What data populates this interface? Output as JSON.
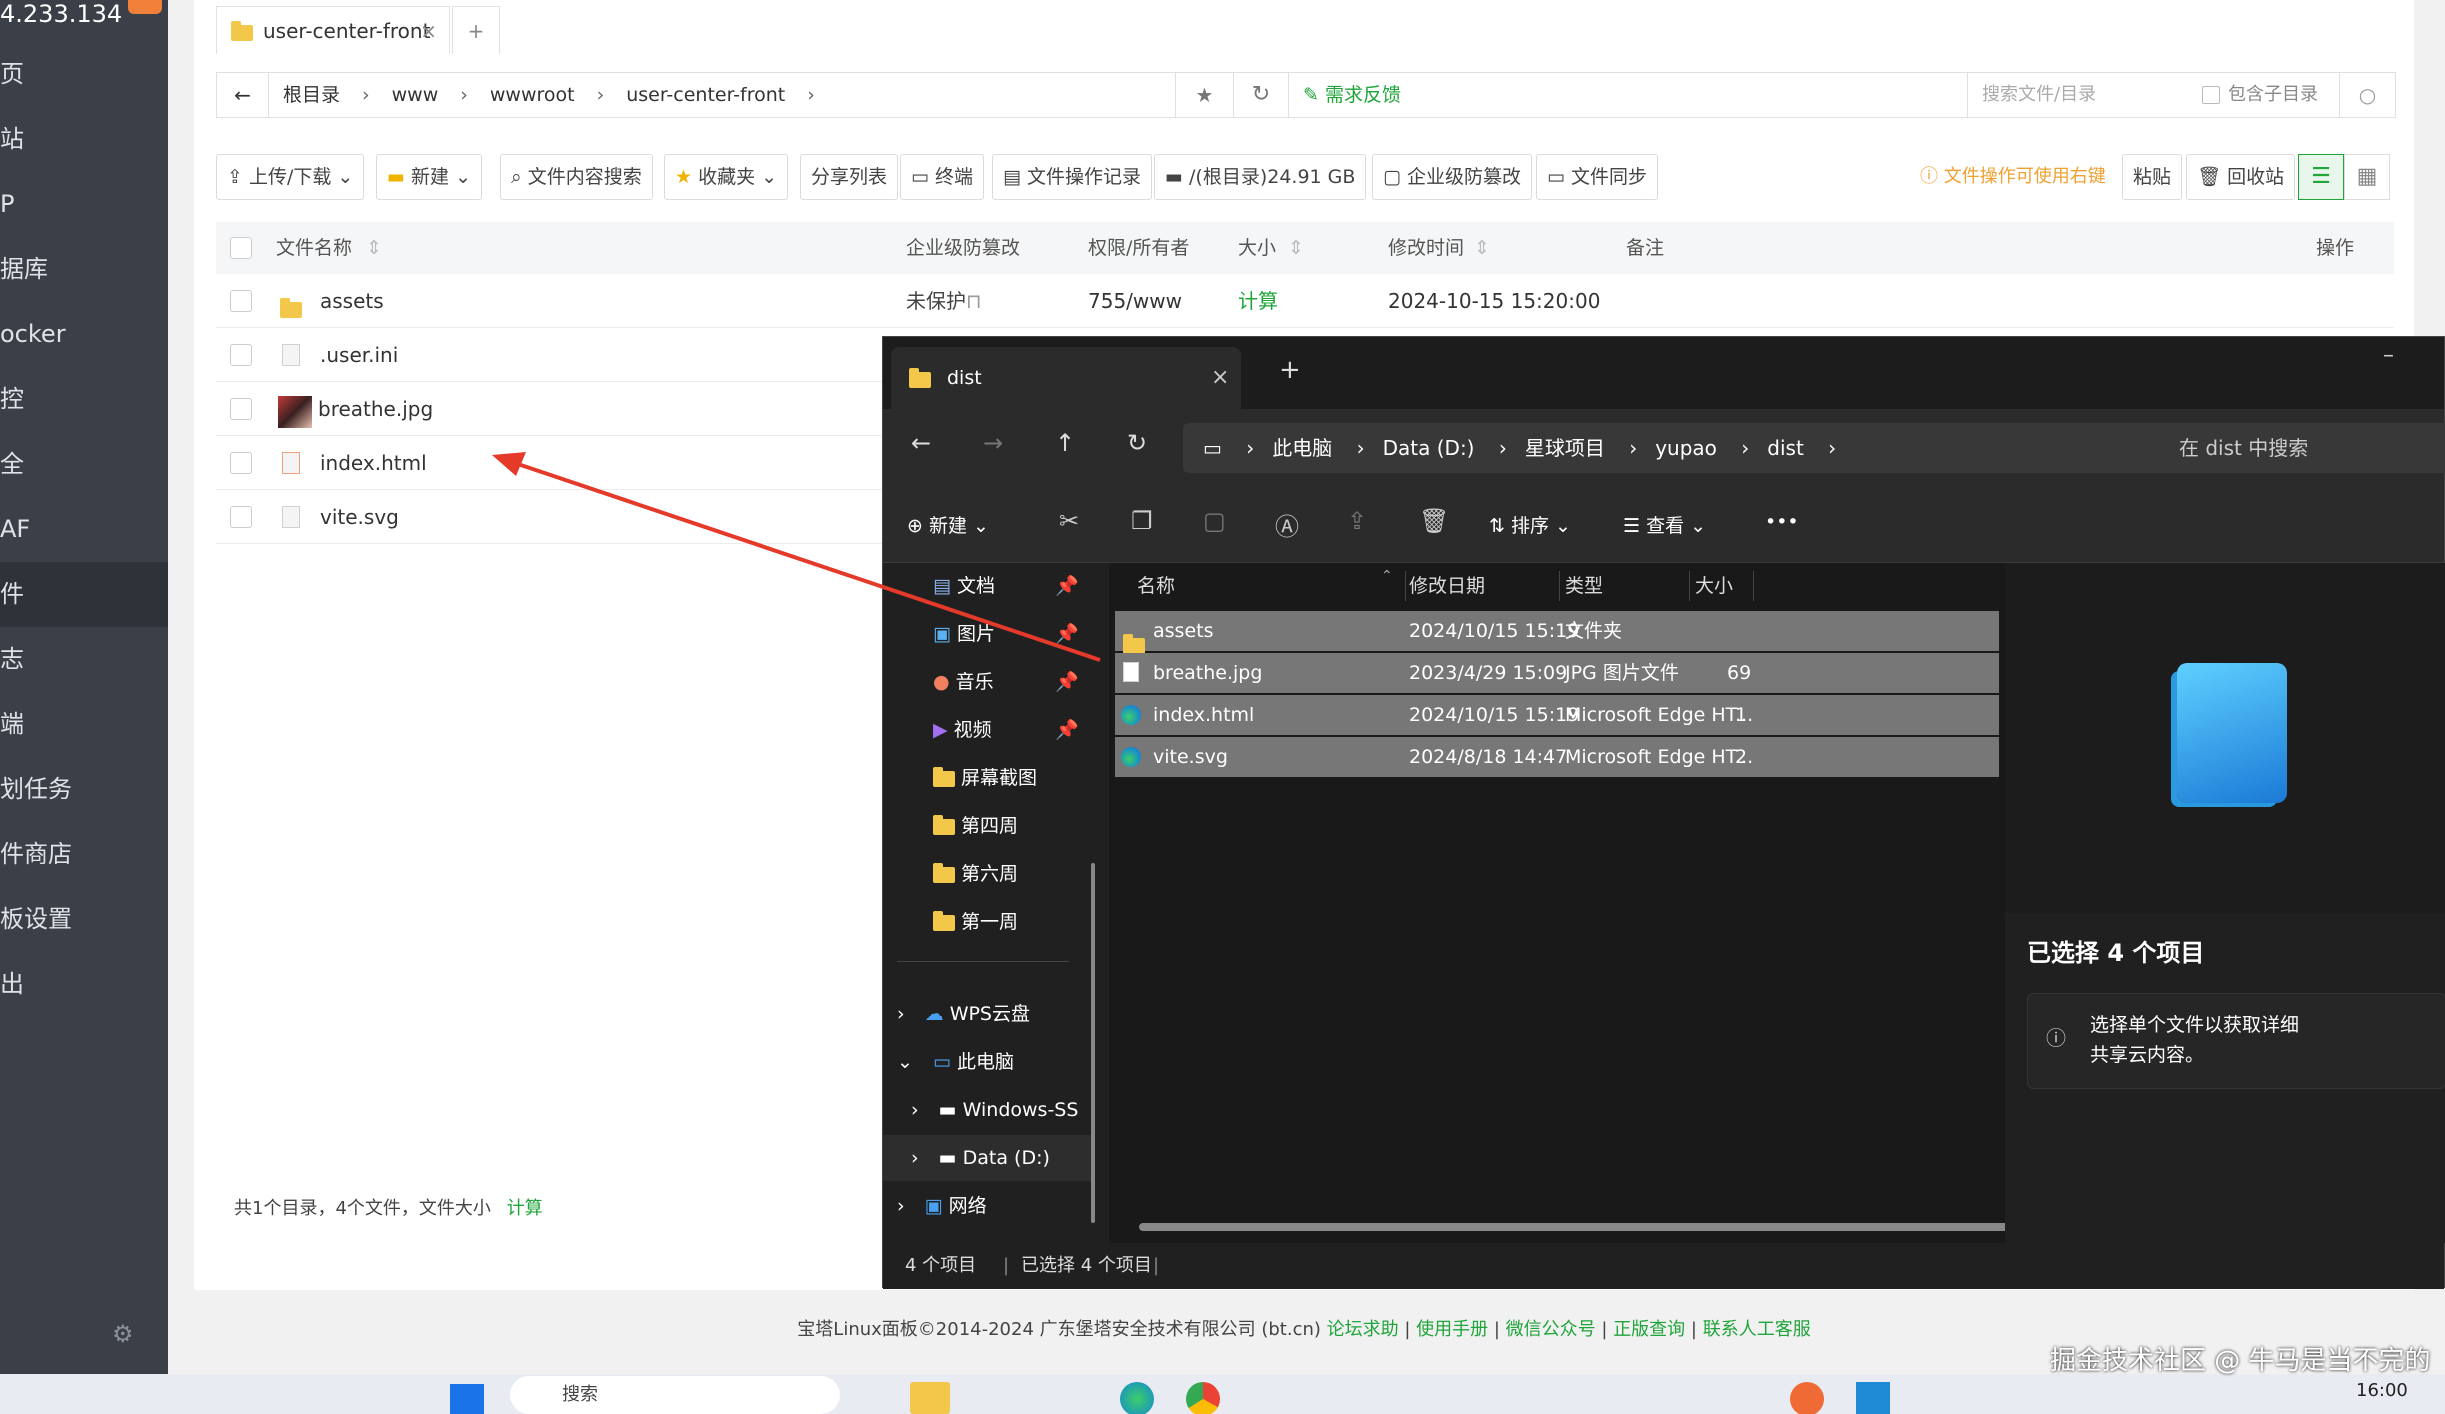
{
  "sidebar": {
    "ip": "4.233.134",
    "items": [
      "页",
      "站",
      "P",
      "据库",
      "ocker",
      "控",
      "全",
      "AF",
      "件",
      "志",
      "端",
      "划任务",
      "件商店",
      "板设置",
      "出"
    ],
    "active_index": 8
  },
  "tabs": {
    "active": "user-center-front",
    "add": "+",
    "close": "×"
  },
  "breadcrumb": {
    "back": "←",
    "parts": [
      "根目录",
      "www",
      "wwwroot",
      "user-center-front"
    ],
    "feedback": "需求反馈",
    "search_placeholder": "搜索文件/目录",
    "include_sub": "包含子目录"
  },
  "toolbar": {
    "upload": "上传/下载",
    "new": "新建",
    "content_search": "文件内容搜索",
    "favorites": "收藏夹",
    "share_list": "分享列表",
    "terminal": "终端",
    "op_log": "文件操作记录",
    "disk": "/(根目录)24.91 GB",
    "tamper": "企业级防篡改",
    "sync": "文件同步",
    "hint": "文件操作可使用右键",
    "paste": "粘贴",
    "recycle": "回收站"
  },
  "table": {
    "headers": [
      "文件名称",
      "企业级防篡改",
      "权限/所有者",
      "大小",
      "修改时间",
      "备注",
      "操作"
    ],
    "rows": [
      {
        "name": "assets",
        "protect": "未保护",
        "perm": "755/www",
        "size": "计算",
        "mtime": "2024-10-15 15:20:00",
        "type": "folder"
      },
      {
        "name": ".user.ini",
        "type": "file"
      },
      {
        "name": "breathe.jpg",
        "type": "image"
      },
      {
        "name": "index.html",
        "type": "html"
      },
      {
        "name": "vite.svg",
        "type": "file"
      }
    ],
    "summary": "共1个目录，4个文件，文件大小",
    "summary_link": "计算"
  },
  "footer": {
    "copyright": "宝塔Linux面板©2014-2024 广东堡塔安全技术有限公司 (bt.cn)",
    "links": [
      "论坛求助",
      "使用手册",
      "微信公众号",
      "正版查询",
      "联系人工客服"
    ]
  },
  "explorer": {
    "tab_title": "dist",
    "path": [
      "此电脑",
      "Data (D:)",
      "星球项目",
      "yupao",
      "dist"
    ],
    "search_placeholder": "在 dist 中搜索",
    "cmd": {
      "new": "新建",
      "sort": "排序",
      "view": "查看",
      "more": "•••"
    },
    "nav": [
      {
        "label": "文档",
        "pin": true
      },
      {
        "label": "图片",
        "pin": true
      },
      {
        "label": "音乐",
        "pin": true
      },
      {
        "label": "视频",
        "pin": true
      },
      {
        "label": "屏幕截图"
      },
      {
        "label": "第四周"
      },
      {
        "label": "第六周"
      },
      {
        "label": "第一周"
      },
      {
        "label": "WPS云盘"
      },
      {
        "label": "此电脑"
      },
      {
        "label": "Windows-SS"
      },
      {
        "label": "Data (D:)"
      },
      {
        "label": "网络"
      }
    ],
    "headers": [
      "名称",
      "修改日期",
      "类型",
      "大小"
    ],
    "files": [
      {
        "name": "assets",
        "date": "2024/10/15 15:19",
        "type": "文件夹",
        "size": ""
      },
      {
        "name": "breathe.jpg",
        "date": "2023/4/29 15:09",
        "type": "JPG 图片文件",
        "size": "69"
      },
      {
        "name": "index.html",
        "date": "2024/10/15 15:19",
        "type": "Microsoft Edge HT...",
        "size": "1"
      },
      {
        "name": "vite.svg",
        "date": "2024/8/18 14:47",
        "type": "Microsoft Edge HT...",
        "size": "2"
      }
    ],
    "detail_title": "已选择 4 个项目",
    "detail_info_line1": "选择单个文件以获取详细",
    "detail_info_line2": "共享云内容。",
    "status_count": "4 个项目",
    "status_selected": "已选择 4 个项目"
  },
  "taskbar": {
    "search": "搜索",
    "time": "16:00"
  },
  "watermark": "掘金技术社区 @ 牛马是当不完的"
}
